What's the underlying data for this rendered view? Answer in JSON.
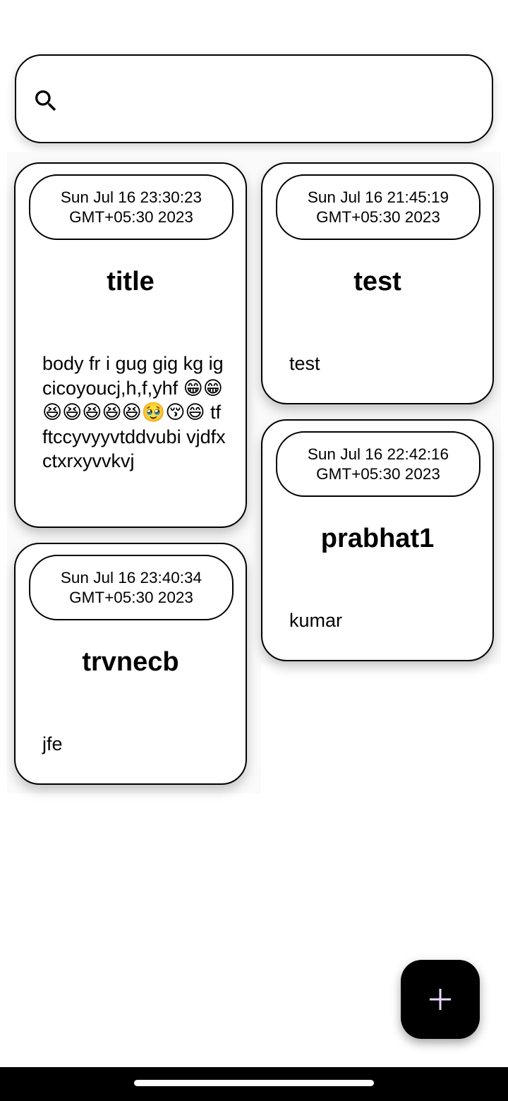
{
  "search": {
    "placeholder": "",
    "value": ""
  },
  "notes": [
    {
      "date": "Sun Jul 16 23:30:23 GMT+05:30 2023",
      "title": "title",
      "body": "body fr i gug gig kg igcicoyoucj,h,f,yhf 😁😁😆😆😆😆😆🥹😚😄 tfftccyvyyvtddvubi vjdfxctxrxyvvkvj"
    },
    {
      "date": "Sun Jul 16 21:45:19 GMT+05:30 2023",
      "title": "test",
      "body": "test"
    },
    {
      "date": "Sun Jul 16 22:42:16 GMT+05:30 2023",
      "title": "prabhat1",
      "body": "kumar"
    },
    {
      "date": "Sun Jul 16 23:40:34 GMT+05:30 2023",
      "title": "trvnecb",
      "body": "jfe"
    }
  ],
  "fab": {
    "icon": "plus-icon",
    "color": "#e8d8ff"
  },
  "colors": {
    "background": "#ffffff",
    "card_border": "#000000",
    "fab_background": "#000000"
  }
}
